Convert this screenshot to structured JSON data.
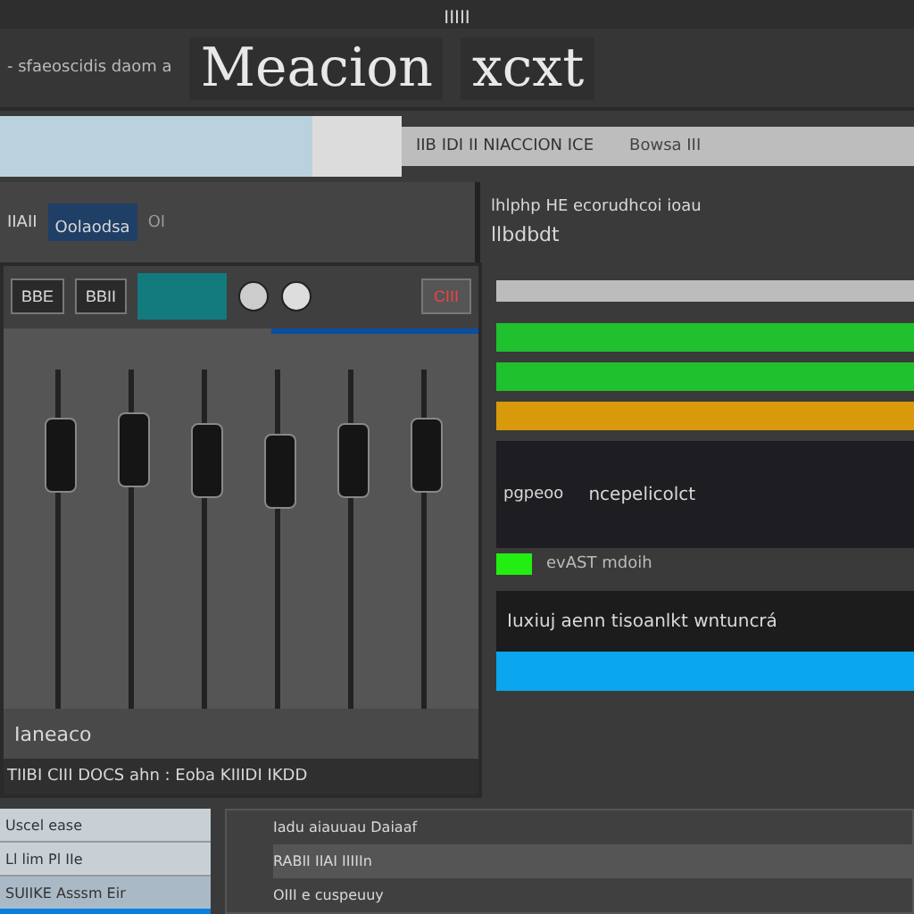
{
  "top_bar": {
    "text": "IIIII"
  },
  "header": {
    "caption": "- sfaeoscidis  daom a",
    "title": "Meacion",
    "title_suffix": "xcxt"
  },
  "toolbar": {
    "text": "IIB IDI II NIACCION ICE",
    "extra": "Bowsa  III"
  },
  "transport": {
    "label": "IIAII",
    "field": "Oolaodsa",
    "digits": "OI"
  },
  "info": {
    "line1": "lhlphp HE ecorudhcoi ioau",
    "line2": "llbdbdt"
  },
  "mixer": {
    "buttons": [
      "BBE",
      "BBII"
    ],
    "preset": "CIII",
    "title": "Ianeaco",
    "footer": "TIIBI CIII DOCS  ahn : Eoba KIIIDI IKDD",
    "channels": [
      {
        "level": 0.82
      },
      {
        "level": 0.84
      },
      {
        "level": 0.8
      },
      {
        "level": 0.76
      },
      {
        "level": 0.8
      },
      {
        "level": 0.82
      }
    ]
  },
  "timeline": {
    "tracks": [
      {
        "color": "#1fc12e"
      },
      {
        "color": "#1fc12e"
      },
      {
        "color": "#d89a0a"
      }
    ],
    "clip_label": "pgpeoo",
    "clip_text": "ncepelicolct",
    "sub": "evAST mdoih",
    "banner": "Iuxiuj aenn tisoanlkt wntuncrá"
  },
  "browser": {
    "rows": [
      {
        "label": "Uscel ease",
        "selected": false
      },
      {
        "label": "Ll lim   Pl IIe",
        "selected": false
      },
      {
        "label": "SUIIKE  Asssm  Eir",
        "selected": true
      }
    ]
  },
  "panel": {
    "rows": [
      {
        "label": "Iadu aiauuau Daiaaf",
        "selected": false
      },
      {
        "label": "RABII IIAI IIIIIn",
        "selected": true
      },
      {
        "label": "OIII  e cuspeuuy",
        "selected": false
      }
    ]
  }
}
